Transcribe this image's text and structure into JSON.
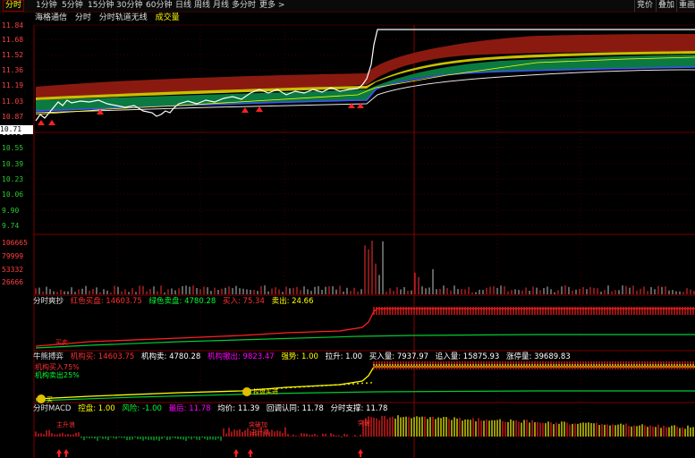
{
  "topbar": {
    "tabs": [
      "分时",
      "1分钟",
      "5分钟",
      "15分钟",
      "30分钟",
      "60分钟",
      "日线",
      "周线",
      "月线",
      "多分时",
      "更多 >"
    ],
    "right_buttons": [
      "竞价",
      "叠加",
      "重画"
    ]
  },
  "subbar": {
    "items": [
      "海格通信",
      "分时",
      "分时轨道无线"
    ],
    "volume_label": "成交量"
  },
  "colors": {
    "red": "#ff2020",
    "green": "#00ff33",
    "yellow": "#ffff00",
    "white": "#ffffff",
    "magenta": "#ff00ff",
    "grid": "#3a0000",
    "axis": "#ff2a2a"
  },
  "price_axis": [
    "11.84",
    "11.68",
    "11.52",
    "11.36",
    "11.19",
    "11.03",
    "10.87",
    "10.71",
    "10.55",
    "10.39",
    "10.23",
    "10.06",
    "9.90",
    "9.74"
  ],
  "volume_axis": [
    "106665",
    "79999",
    "53332",
    "26666"
  ],
  "panel1": {
    "title": "分时爽抄",
    "items": [
      {
        "label": "红色买盘: 14603.75",
        "color": "#ff3030"
      },
      {
        "label": "绿色卖盘: 4780.28",
        "color": "#00ff33"
      },
      {
        "label": "买入: 75.34",
        "color": "#ff3030"
      },
      {
        "label": "卖出: 24.66",
        "color": "#ffff00"
      }
    ],
    "marker": "买卖"
  },
  "panel2": {
    "title": "牛熊搏弈",
    "items": [
      {
        "label": "机构买: 14603.75",
        "color": "#ff3030"
      },
      {
        "label": "机构卖: 4780.28",
        "color": "#ffffff"
      },
      {
        "label": "机构撤出: 9823.47",
        "color": "#ff00ff"
      },
      {
        "label": "强势: 1.00",
        "color": "#ffff00"
      },
      {
        "label": "拉升: 1.00",
        "color": "#ffffff"
      },
      {
        "label": "买入量: 7937.97",
        "color": "#ffffff"
      },
      {
        "label": "追入量: 15875.93",
        "color": "#ffffff"
      },
      {
        "label": "涨停量: 39689.83",
        "color": "#ffffff"
      }
    ],
    "legend_a": "机构买入75%",
    "legend_b": "机构卖出25%",
    "bubble_1": "买",
    "bubble_2": "控盘买进"
  },
  "panel3": {
    "title": "分时MACD",
    "items": [
      {
        "label": "控盘: 1.00",
        "color": "#ffff00"
      },
      {
        "label": "风险: -1.00",
        "color": "#00ff33"
      },
      {
        "label": "最后: 11.78",
        "color": "#ff00ff"
      },
      {
        "label": "均价: 11.39",
        "color": "#ffffff"
      },
      {
        "label": "回调认同: 11.78",
        "color": "#ffffff"
      },
      {
        "label": "分时支撑: 11.78",
        "color": "#ffffff"
      }
    ],
    "tags": [
      "主升浪",
      "突破加",
      "主升浪",
      "突破"
    ]
  }
}
